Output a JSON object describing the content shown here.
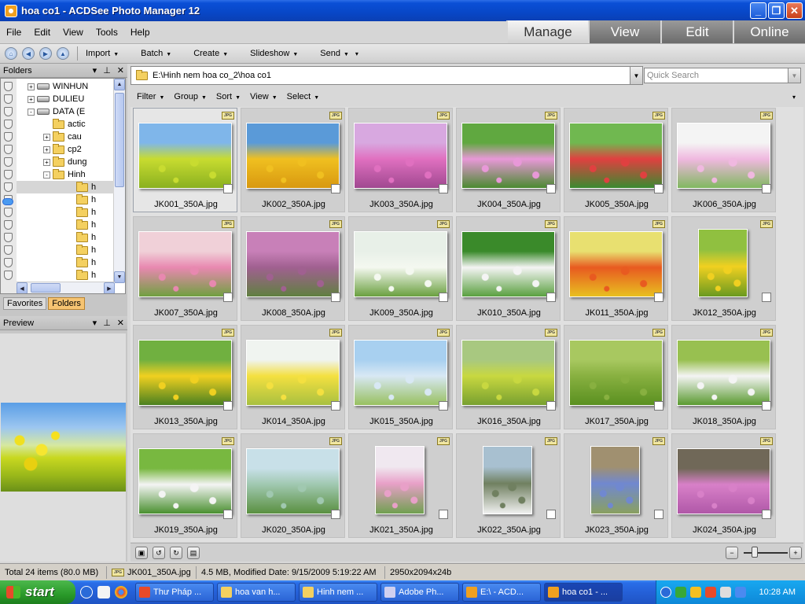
{
  "window": {
    "title": "hoa co1 - ACDSee Photo Manager 12"
  },
  "menu": [
    "File",
    "Edit",
    "View",
    "Tools",
    "Help"
  ],
  "modes": [
    {
      "label": "Manage",
      "active": true
    },
    {
      "label": "View",
      "active": false
    },
    {
      "label": "Edit",
      "active": false
    },
    {
      "label": "Online",
      "active": false
    }
  ],
  "toolbar": {
    "items": [
      "Import",
      "Batch",
      "Create",
      "Slideshow",
      "Send"
    ]
  },
  "folders_panel": {
    "title": "Folders",
    "rows": [
      {
        "label": "WINHUN",
        "type": "drive",
        "expander": "+"
      },
      {
        "label": "DULIEU",
        "type": "drive",
        "expander": "+"
      },
      {
        "label": "DATA (E",
        "type": "drive",
        "expander": "-"
      },
      {
        "label": "actic",
        "type": "folder",
        "expander": ""
      },
      {
        "label": "cau",
        "type": "folder",
        "expander": "+"
      },
      {
        "label": "cp2",
        "type": "folder",
        "expander": "+"
      },
      {
        "label": "dung",
        "type": "folder",
        "expander": "+"
      },
      {
        "label": "Hinh",
        "type": "folder",
        "expander": "-"
      },
      {
        "label": "h",
        "type": "folder",
        "expander": "",
        "selected": true
      },
      {
        "label": "h",
        "type": "folder",
        "expander": ""
      },
      {
        "label": "h",
        "type": "folder",
        "expander": ""
      },
      {
        "label": "h",
        "type": "folder",
        "expander": ""
      },
      {
        "label": "h",
        "type": "folder",
        "expander": ""
      },
      {
        "label": "h",
        "type": "folder",
        "expander": ""
      },
      {
        "label": "h",
        "type": "folder",
        "expander": ""
      },
      {
        "label": "h",
        "type": "folder",
        "expander": ""
      }
    ]
  },
  "panel_tabs": [
    {
      "label": "Favorites",
      "active": false
    },
    {
      "label": "Folders",
      "active": true
    }
  ],
  "preview_panel": {
    "title": "Preview"
  },
  "address": {
    "path": "E:\\Hinh nem hoa co_2\\hoa co1"
  },
  "search": {
    "placeholder": "Quick Search"
  },
  "filterbar": [
    "Filter",
    "Group",
    "Sort",
    "View",
    "Select"
  ],
  "thumbnails": [
    {
      "name": "JK001_350A.jpg",
      "colors": [
        "#7fb6ea",
        "#c8dc30",
        "#8ab020"
      ],
      "portrait": false
    },
    {
      "name": "JK002_350A.jpg",
      "colors": [
        "#5a9ad8",
        "#f0c020",
        "#d89810"
      ],
      "portrait": false
    },
    {
      "name": "JK003_350A.jpg",
      "colors": [
        "#d8a8e0",
        "#e070c0",
        "#a04890"
      ],
      "portrait": false
    },
    {
      "name": "JK004_350A.jpg",
      "colors": [
        "#60a840",
        "#e898d8",
        "#4a8a30"
      ],
      "portrait": false
    },
    {
      "name": "JK005_350A.jpg",
      "colors": [
        "#70b850",
        "#e04040",
        "#3a8a30"
      ],
      "portrait": false
    },
    {
      "name": "JK006_350A.jpg",
      "colors": [
        "#f4f4f4",
        "#f0b8e0",
        "#80b860"
      ],
      "portrait": false
    },
    {
      "name": "JK007_350A.jpg",
      "colors": [
        "#f0d0d8",
        "#e888b0",
        "#70a040"
      ],
      "portrait": false
    },
    {
      "name": "JK008_350A.jpg",
      "colors": [
        "#c880b8",
        "#a06090",
        "#608040"
      ],
      "portrait": false
    },
    {
      "name": "JK009_350A.jpg",
      "colors": [
        "#e8f0e8",
        "#f4f8f0",
        "#6aa040"
      ],
      "portrait": false
    },
    {
      "name": "JK010_350A.jpg",
      "colors": [
        "#3a8a2a",
        "#f4f4f4",
        "#5aa040"
      ],
      "portrait": false
    },
    {
      "name": "JK011_350A.jpg",
      "colors": [
        "#e8e070",
        "#e85a20",
        "#e8c020"
      ],
      "portrait": false
    },
    {
      "name": "JK012_350A.jpg",
      "colors": [
        "#90c040",
        "#f0d020",
        "#6a9a20"
      ],
      "portrait": true
    },
    {
      "name": "JK013_350A.jpg",
      "colors": [
        "#70b040",
        "#f0d020",
        "#4a8020"
      ],
      "portrait": false
    },
    {
      "name": "JK014_350A.jpg",
      "colors": [
        "#f0f4f0",
        "#f4e040",
        "#a8c040"
      ],
      "portrait": false
    },
    {
      "name": "JK015_350A.jpg",
      "colors": [
        "#a8d0f0",
        "#d8e8f4",
        "#98c060"
      ],
      "portrait": false
    },
    {
      "name": "JK016_350A.jpg",
      "colors": [
        "#a8c880",
        "#c8d840",
        "#78a030"
      ],
      "portrait": false
    },
    {
      "name": "JK017_350A.jpg",
      "colors": [
        "#a8c860",
        "#88b040",
        "#5a9020"
      ],
      "portrait": false
    },
    {
      "name": "JK018_350A.jpg",
      "colors": [
        "#98c050",
        "#f4f4f4",
        "#5a9a30"
      ],
      "portrait": false
    },
    {
      "name": "JK019_350A.jpg",
      "colors": [
        "#78b840",
        "#f4f4f4",
        "#4a9030"
      ],
      "portrait": false
    },
    {
      "name": "JK020_350A.jpg",
      "colors": [
        "#c8e0e8",
        "#a0c8b0",
        "#5a9040"
      ],
      "portrait": false
    },
    {
      "name": "JK021_350A.jpg",
      "colors": [
        "#f0e8f0",
        "#e8a0c8",
        "#70a050"
      ],
      "portrait": true
    },
    {
      "name": "JK022_350A.jpg",
      "colors": [
        "#a8c0d0",
        "#708060",
        "#f0f0f0"
      ],
      "portrait": true
    },
    {
      "name": "JK023_350A.jpg",
      "colors": [
        "#a09070",
        "#7088d0",
        "#8aa060"
      ],
      "portrait": true
    },
    {
      "name": "JK024_350A.jpg",
      "colors": [
        "#706858",
        "#d880c8",
        "#b058a8"
      ],
      "portrait": false
    }
  ],
  "status": {
    "total": "Total 24 items  (80.0 MB)",
    "file": "JK001_350A.jpg",
    "info": "4.5 MB, Modified Date: 9/15/2009 5:19:22 AM",
    "dims": "2950x2094x24b"
  },
  "taskbar": {
    "start": "start",
    "tasks": [
      {
        "label": "Thư Pháp ...",
        "color": "#e84a2a",
        "active": false
      },
      {
        "label": "hoa van h...",
        "color": "#f4d060",
        "active": false
      },
      {
        "label": "Hinh nem ...",
        "color": "#f4d060",
        "active": false
      },
      {
        "label": "Adobe Ph...",
        "color": "#d0d0f0",
        "active": false
      },
      {
        "label": "E:\\ - ACD...",
        "color": "#f0a020",
        "active": false
      },
      {
        "label": "hoa co1 - ...",
        "color": "#f0a020",
        "active": true
      }
    ],
    "clock": "10:28 AM"
  }
}
